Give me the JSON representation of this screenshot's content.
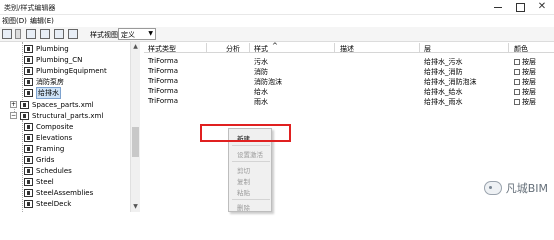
{
  "window": {
    "title": "类别/样式编辑器"
  },
  "menu": {
    "items": [
      "视图(D)",
      "编辑(E)"
    ]
  },
  "toolbar": {
    "style_view_label": "样式视图",
    "style_view_value": "定义"
  },
  "tree": {
    "items": [
      {
        "label": "Plumbing",
        "selected": false
      },
      {
        "label": "Plumbing_CN",
        "selected": false
      },
      {
        "label": "PlumbingEquipment",
        "selected": false
      },
      {
        "label": "消防泵房",
        "selected": false
      },
      {
        "label": "给排水",
        "selected": true
      },
      {
        "label": "Spaces_parts.xml",
        "selected": false
      },
      {
        "label": "Structural_parts.xml",
        "selected": false
      },
      {
        "label": "Composite",
        "selected": false
      },
      {
        "label": "Elevations",
        "selected": false
      },
      {
        "label": "Framing",
        "selected": false
      },
      {
        "label": "Grids",
        "selected": false
      },
      {
        "label": "Schedules",
        "selected": false
      },
      {
        "label": "Steel",
        "selected": false
      },
      {
        "label": "SteelAssemblies",
        "selected": false
      },
      {
        "label": "SteelDeck",
        "selected": false
      }
    ]
  },
  "table": {
    "headers": {
      "style_type": "样式类型",
      "analysis": "分析",
      "style": "样式",
      "description": "描述",
      "level": "层",
      "color": "颜色"
    },
    "rows": [
      {
        "style_type": "TriForma",
        "style": "污水",
        "level": "给排水_污水",
        "color": "按层"
      },
      {
        "style_type": "TriForma",
        "style": "消防",
        "level": "给排水_消防",
        "color": "按层"
      },
      {
        "style_type": "TriForma",
        "style": "消防泡沫",
        "level": "给排水_消防泡沫",
        "color": "按层"
      },
      {
        "style_type": "TriForma",
        "style": "给水",
        "level": "给排水_给水",
        "color": "按层"
      },
      {
        "style_type": "TriForma",
        "style": "雨水",
        "level": "给排水_雨水",
        "color": "按层"
      }
    ]
  },
  "context_menu": {
    "items": [
      "新建",
      "设置激活",
      "剪切",
      "复制",
      "粘贴",
      "删除"
    ]
  },
  "watermark": {
    "text": "凡城BIM"
  },
  "colors": {
    "highlight": "#e02020",
    "selection": "#cfe3f7"
  }
}
